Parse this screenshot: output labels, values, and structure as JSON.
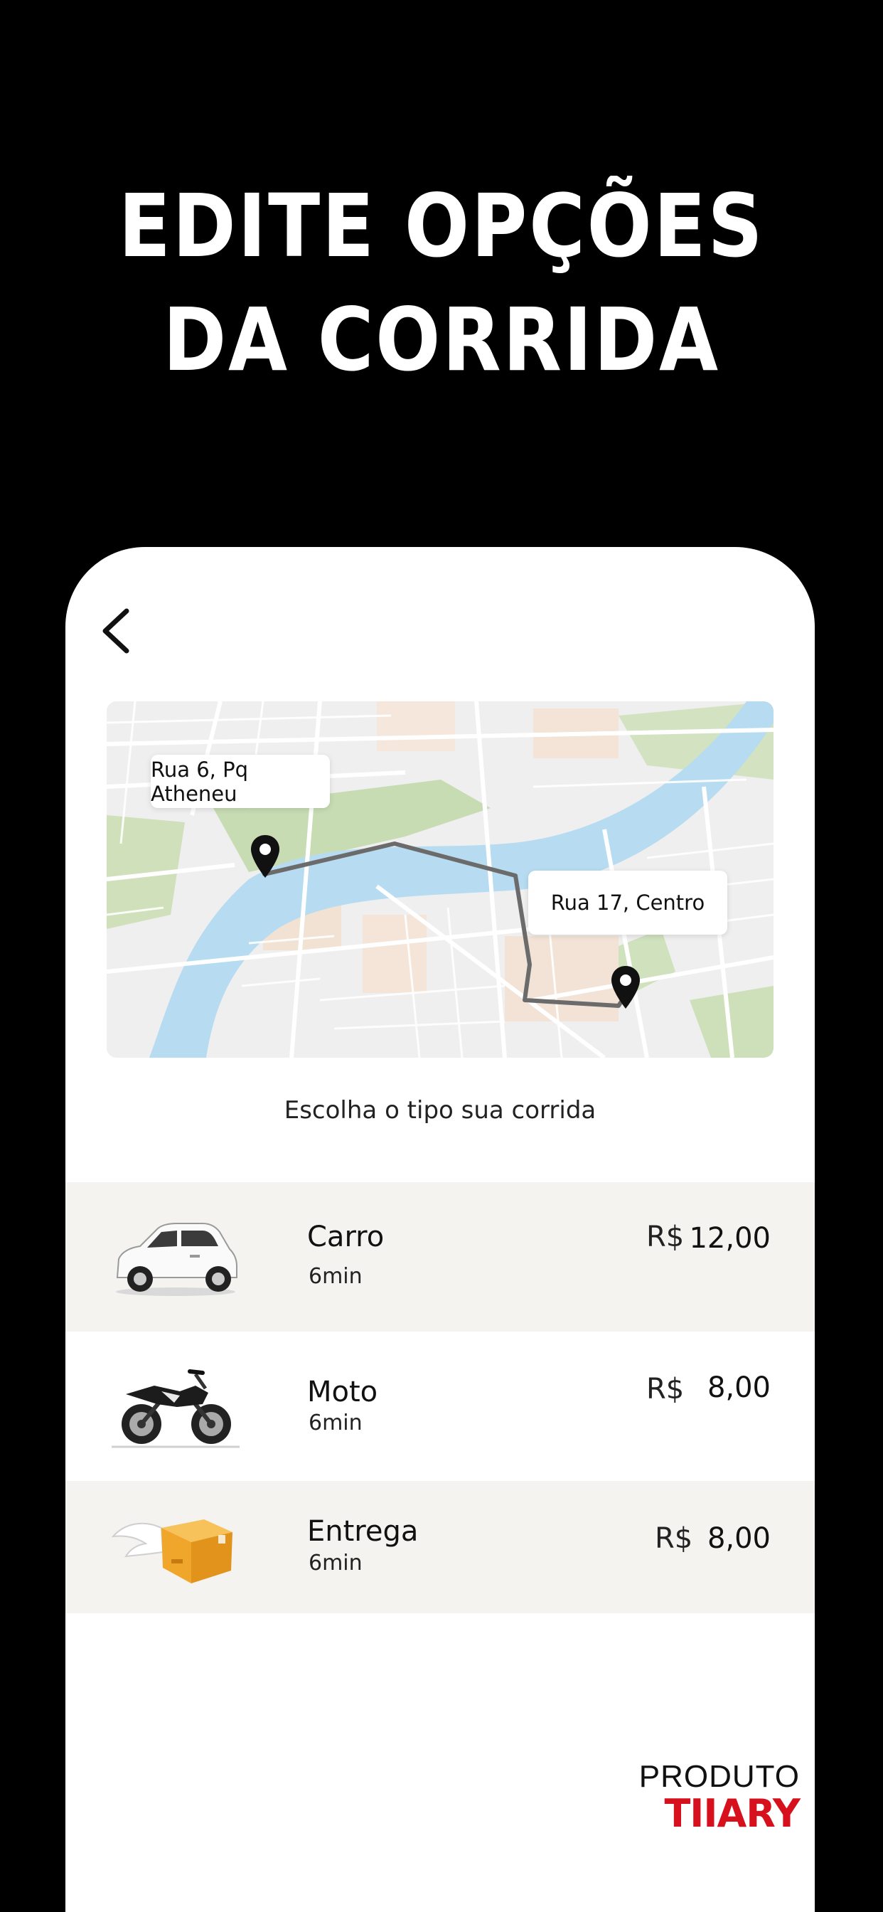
{
  "headline": {
    "line1": "EDITE OPÇÕES",
    "line2": "DA CORRIDA"
  },
  "header": {
    "back_icon": "chevron-left-icon"
  },
  "map": {
    "origin_label": "Rua 6, Pq Atheneu",
    "destination_label": "Rua 17, Centro",
    "pin_icon": "map-pin-icon"
  },
  "subtitle": "Escolha o tipo sua corrida",
  "rides": [
    {
      "name": "Carro",
      "time": "6min",
      "currency": "R$",
      "amount": "12,00",
      "icon": "car-icon"
    },
    {
      "name": "Moto",
      "time": "6min",
      "currency": "R$",
      "amount": "8,00",
      "icon": "motorcycle-icon"
    },
    {
      "name": "Entrega",
      "time": "6min",
      "currency": "R$",
      "amount": "8,00",
      "icon": "winged-box-icon"
    }
  ],
  "brand": {
    "top": "PRODUTO",
    "bottom": "TIIARY"
  },
  "colors": {
    "background": "#000000",
    "card": "#ffffff",
    "row_shaded": "#f4f3ef",
    "river": "#b7dcf1",
    "park": "#c8dcb3",
    "route": "#6b6b6b",
    "brand_red": "#d6101d"
  }
}
